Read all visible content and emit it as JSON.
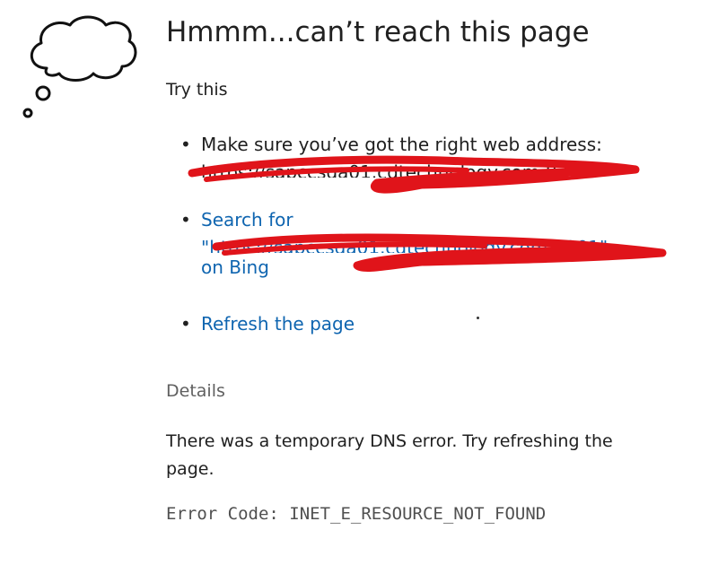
{
  "error": {
    "title": "Hmmm...can’t reach this page",
    "try_this": "Try this",
    "suggestions": [
      {
        "text": "Make sure you’ve got the right web address:",
        "url": "https://sapccsqa01.cdtechnology.com:8201"
      },
      {
        "prefix": "Search for",
        "query": "\"https://sapccsqa01.cdtechnology.com:8201\"",
        "suffix": "on Bing"
      },
      {
        "text": "Refresh the page"
      }
    ],
    "details_label": "Details",
    "details_text": "There was a temporary DNS error. Try refreshing the page.",
    "error_code": "Error Code: INET_E_RESOURCE_NOT_FOUND"
  },
  "colors": {
    "link": "#0f65b0",
    "redaction": "#e0141a",
    "text": "#202020",
    "muted": "#606060"
  },
  "icons": [
    "thought-cloud-icon"
  ]
}
